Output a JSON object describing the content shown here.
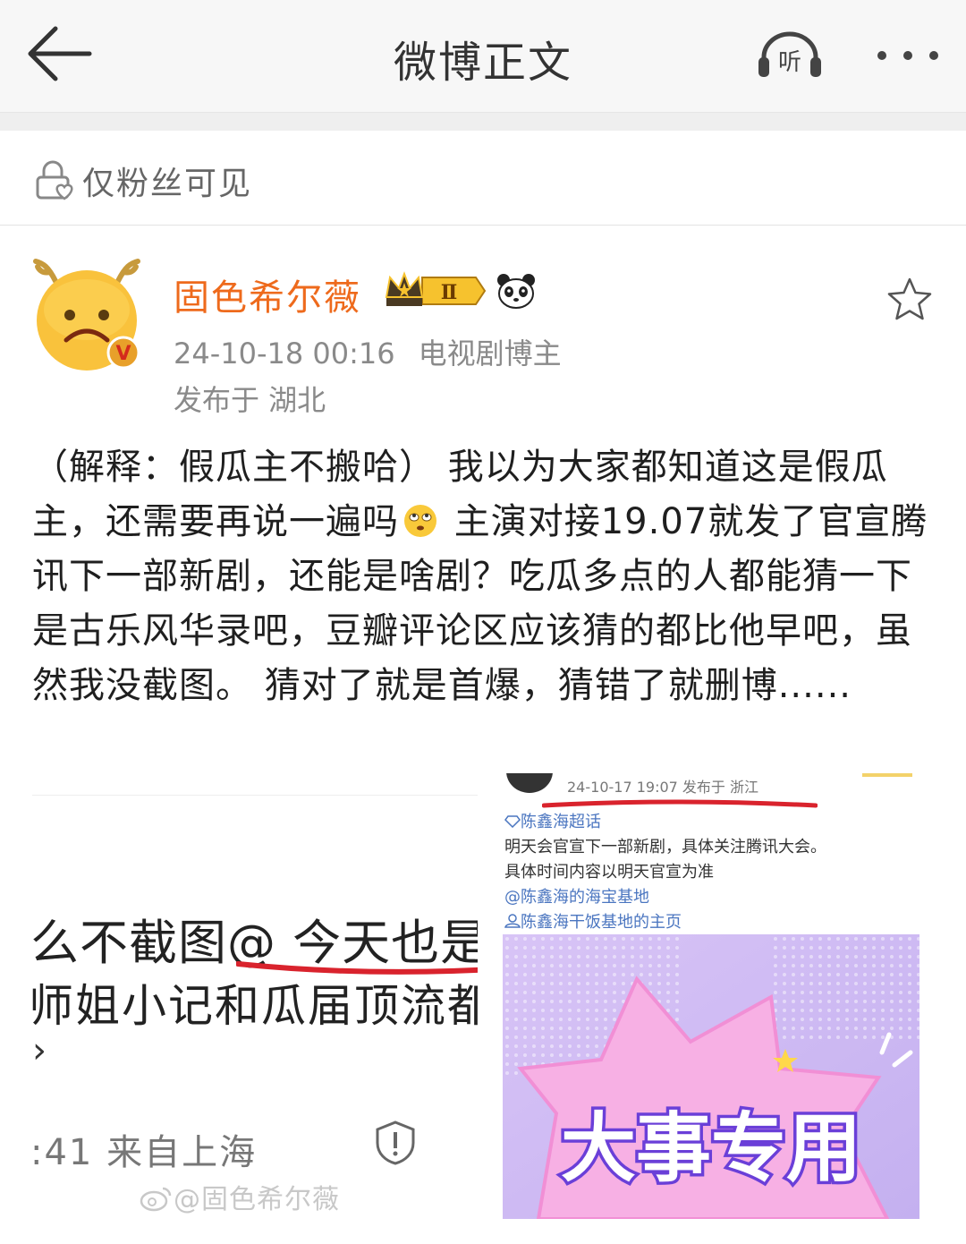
{
  "nav": {
    "title": "微博正文",
    "listen_label": "听",
    "back_icon": "back-arrow-icon",
    "more_icon": "more-dots-icon"
  },
  "visibility": {
    "text": "仅粉丝可见",
    "icon": "lock-heart-icon"
  },
  "author": {
    "name": "固色希尔薇",
    "badge_label": "Ⅱ",
    "datetime": "24-10-18 00:16",
    "role": "电视剧博主",
    "location": "发布于 湖北"
  },
  "post": {
    "part1": "（解释：假瓜主不搬哈）  我以为大家都知道这是假瓜主，还需要再说一遍吗",
    "part2": " 主演对接19.07就发了官宣腾讯下一部新剧，还能是啥剧？吃瓜多点的人都能猜一下是古乐风华录吧，豆瓣评论区应该猜的都比他早吧，虽然我没截图。 猜对了就是首爆，猜错了就删博......"
  },
  "left_screenshot": {
    "line1": "么不截图@ 今天也是",
    "line2": "师姐小记和瓜届顶流都",
    "line3": "›",
    "time": ":41 来自上海",
    "watermark": "@固色希尔薇"
  },
  "right_screenshot": {
    "date": "24-10-17 19:07  发布于 浙江",
    "topic": "陈鑫海超话",
    "text1": "明天会官宣下一部新剧，具体关注腾讯大会。",
    "text2": "具体时间内容以明天官宣为准",
    "link1": "@陈鑫海的海宝基地",
    "link2": "陈鑫海干饭基地的主页",
    "banner_text": "大事专用"
  },
  "colors": {
    "author_name": "#ee6a1c",
    "link_blue": "#4b76c0",
    "underline_red": "#d9232d"
  }
}
